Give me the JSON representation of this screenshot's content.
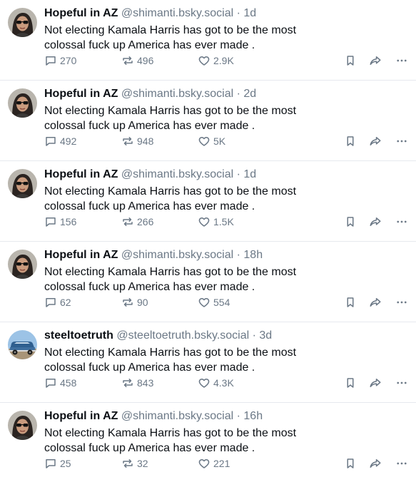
{
  "posts": [
    {
      "name": "Hopeful in AZ",
      "handle": "@shimanti.bsky.social",
      "time": "1d",
      "text": "Not electing Kamala Harris has got to be the most colossal fuck up America has ever made .",
      "replies": "270",
      "reposts": "496",
      "likes": "2.9K",
      "avatar": "woman-avatar"
    },
    {
      "name": "Hopeful in AZ",
      "handle": "@shimanti.bsky.social",
      "time": "2d",
      "text": "Not electing Kamala Harris has got to be the most colossal fuck up America has ever made .",
      "replies": "492",
      "reposts": "948",
      "likes": "5K",
      "avatar": "woman-avatar"
    },
    {
      "name": "Hopeful in AZ",
      "handle": "@shimanti.bsky.social",
      "time": "1d",
      "text": "Not electing Kamala Harris has got to be the most colossal fuck up America has ever made .",
      "replies": "156",
      "reposts": "266",
      "likes": "1.5K",
      "avatar": "woman-avatar"
    },
    {
      "name": "Hopeful in AZ",
      "handle": "@shimanti.bsky.social",
      "time": "18h",
      "text": "Not electing Kamala Harris has got to be the most colossal fuck up America has ever made .",
      "replies": "62",
      "reposts": "90",
      "likes": "554",
      "avatar": "woman-avatar"
    },
    {
      "name": "steeltoetruth",
      "handle": "@steeltoetruth.bsky.social",
      "time": "3d",
      "text": "Not electing Kamala Harris has got to be the most colossal fuck up America has ever made .",
      "replies": "458",
      "reposts": "843",
      "likes": "4.3K",
      "avatar": "truck-avatar"
    },
    {
      "name": "Hopeful in AZ",
      "handle": "@shimanti.bsky.social",
      "time": "16h",
      "text": "Not electing Kamala Harris has got to be the most colossal fuck up America has ever made .",
      "replies": "25",
      "reposts": "32",
      "likes": "221",
      "avatar": "woman-avatar"
    }
  ],
  "separator": " · ",
  "colors": {
    "text": "#0b0f14",
    "muted": "#6b7886",
    "divider": "#e6e9ee"
  }
}
